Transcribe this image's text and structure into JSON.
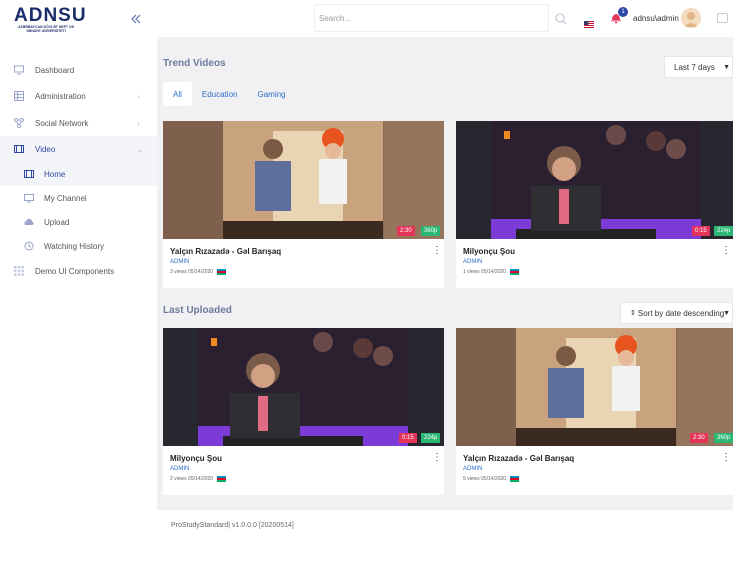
{
  "brand": {
    "name": "ADNSU",
    "subtitle": "AZƏRBAYCAN DÖVLƏT NEFT VƏ SƏNAYE UNİVERSİTETİ"
  },
  "sidebar": {
    "collapse_icon": "double-chevron-left-icon",
    "items": [
      {
        "label": "Dashboard",
        "icon": "monitor-icon",
        "has_children": false
      },
      {
        "label": "Administration",
        "icon": "table-icon",
        "has_children": true
      },
      {
        "label": "Social Network",
        "icon": "network-icon",
        "has_children": true
      },
      {
        "label": "Video",
        "icon": "film-icon",
        "has_children": true,
        "expanded": true,
        "children": [
          {
            "label": "Home",
            "icon": "film-icon",
            "active": true
          },
          {
            "label": "My Channel",
            "icon": "monitor-icon"
          },
          {
            "label": "Upload",
            "icon": "upload-icon"
          },
          {
            "label": "Watching History",
            "icon": "history-icon"
          }
        ]
      },
      {
        "label": "Demo UI Components",
        "icon": "grid-icon",
        "has_children": false
      }
    ]
  },
  "header": {
    "search_placeholder": "Search...",
    "notification_count": "1",
    "username": "adnsu\\admin"
  },
  "trend": {
    "title": "Trend Videos",
    "range_selected": "Last 7 days",
    "tabs": [
      {
        "label": "All",
        "active": true
      },
      {
        "label": "Education",
        "active": false
      },
      {
        "label": "Gaming",
        "active": false
      }
    ],
    "videos": [
      {
        "title": "Yalçın Rızazadə - Gəl Barışaq",
        "author": "ADMIN",
        "meta": "3 views 05/14/2020",
        "duration": "2:30",
        "resolution": "360p",
        "thumb": "piano"
      },
      {
        "title": "Milyonçu Şou",
        "author": "ADMIN",
        "meta": "1 views 05/14/2020",
        "duration": "0:15",
        "resolution": "224p",
        "thumb": "show"
      }
    ]
  },
  "latest": {
    "title": "Last Uploaded",
    "sort_label": "Sort by date descending",
    "videos": [
      {
        "title": "Milyonçu Şou",
        "author": "ADMIN",
        "meta": "2 views 05/14/2020",
        "duration": "0:15",
        "resolution": "224p",
        "thumb": "show"
      },
      {
        "title": "Yalçın Rızazadə - Gəl Barışaq",
        "author": "ADMIN",
        "meta": "5 views 05/14/2020",
        "duration": "2:30",
        "resolution": "360p",
        "thumb": "piano"
      }
    ]
  },
  "footer": {
    "text": "ProStudyStandard| v1.0.0.0 [20200514]"
  },
  "colors": {
    "accent": "#2c4aa6",
    "link": "#2c6dc7",
    "duration": "#e3355a",
    "resolution": "#2bb673"
  }
}
